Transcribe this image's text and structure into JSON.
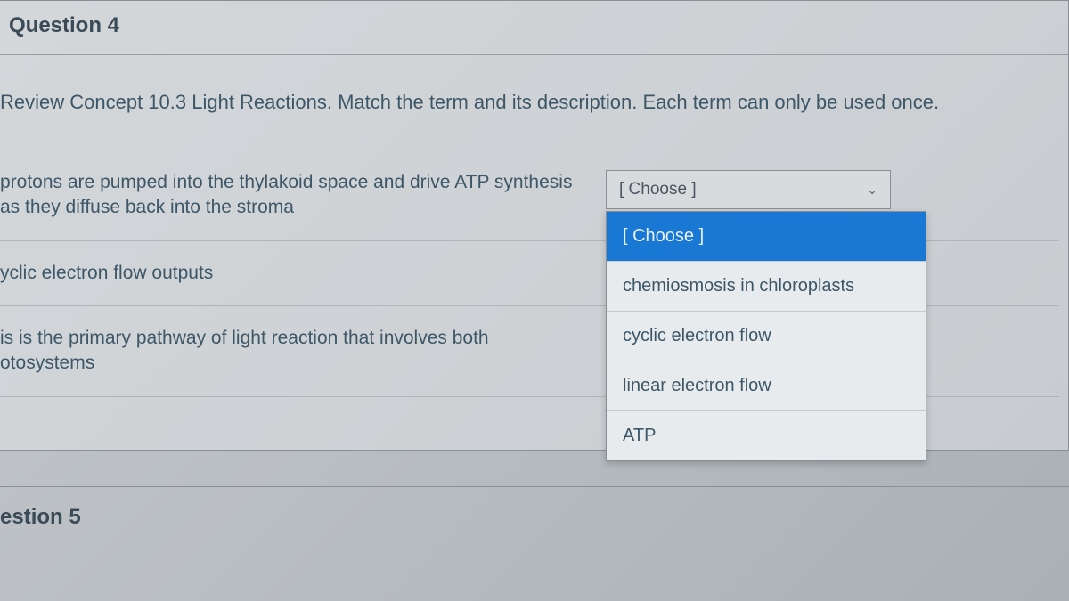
{
  "question": {
    "title": "Question 4",
    "instruction": "Review Concept 10.3 Light Reactions. Match the term and its description. Each term can only be used once."
  },
  "rows": [
    {
      "prompt": "protons are pumped into the thylakoid space and drive ATP synthesis as they diffuse back into the stroma",
      "selected": "[ Choose ]"
    },
    {
      "prompt": "yclic electron flow outputs",
      "selected": ""
    },
    {
      "prompt": "is is the primary pathway of light reaction that involves both otosystems",
      "selected": ""
    }
  ],
  "dropdown": {
    "placeholder": "[ Choose ]",
    "options": [
      "chemiosmosis in chloroplasts",
      "cyclic electron flow",
      "linear electron flow",
      "ATP"
    ]
  },
  "next_question": {
    "title": "estion 5"
  }
}
